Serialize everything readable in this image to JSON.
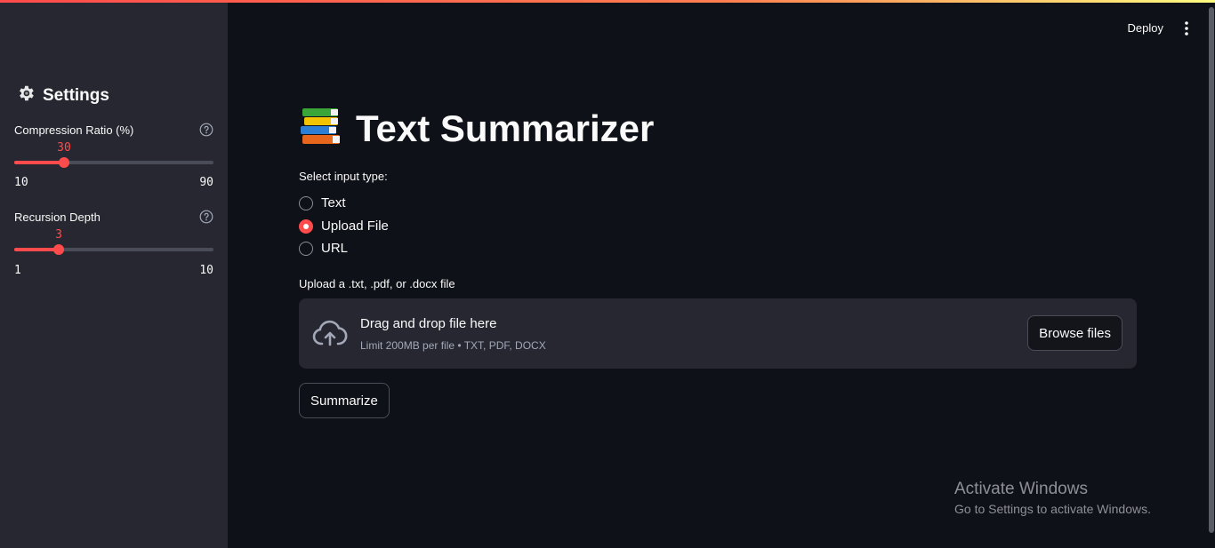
{
  "colors": {
    "accent": "#ff4b4b",
    "background": "#0e1117",
    "sidebar": "#262730"
  },
  "header": {
    "deploy_label": "Deploy",
    "menu_icon": "vertical-ellipsis-icon"
  },
  "sidebar": {
    "title": "Settings",
    "title_icon": "gear-icon",
    "sliders": [
      {
        "label": "Compression Ratio (%)",
        "value": "30",
        "min": "10",
        "max": "90",
        "help_icon": "question-circle-icon"
      },
      {
        "label": "Recursion Depth",
        "value": "3",
        "min": "1",
        "max": "10",
        "help_icon": "question-circle-icon"
      }
    ]
  },
  "main": {
    "title": "Text Summarizer",
    "title_icon": "books-emoji-icon",
    "input_type": {
      "label": "Select input type:",
      "options": [
        "Text",
        "Upload File",
        "URL"
      ],
      "selected": "Upload File"
    },
    "uploader": {
      "label": "Upload a .txt, .pdf, or .docx file",
      "drop_title": "Drag and drop file here",
      "drop_sub": "Limit 200MB per file • TXT, PDF, DOCX",
      "browse_label": "Browse files",
      "icon": "cloud-upload-icon"
    },
    "summarize_label": "Summarize"
  },
  "watermark": {
    "title": "Activate Windows",
    "subtitle": "Go to Settings to activate Windows."
  }
}
